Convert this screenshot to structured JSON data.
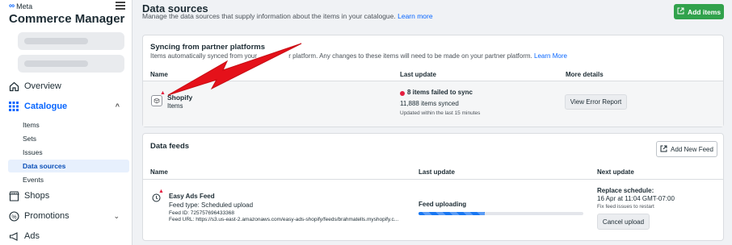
{
  "sidebar": {
    "brand": "Meta",
    "title": "Commerce Manager",
    "nav": [
      {
        "label": "Overview"
      },
      {
        "label": "Catalogue"
      },
      {
        "label": "Shops"
      },
      {
        "label": "Promotions"
      },
      {
        "label": "Ads"
      }
    ],
    "catalogue_items": [
      "Items",
      "Sets",
      "Issues",
      "Data sources",
      "Events"
    ]
  },
  "header": {
    "title": "Data sources",
    "subtitle": "Manage the data sources that supply information about the items in your catalogue.",
    "learn_more": "Learn more",
    "add_items": "Add items"
  },
  "partner": {
    "title": "Syncing from partner platforms",
    "subtitle_left": "Items automatically synced from your",
    "subtitle_right": "r platform. Any changes to these items will need to be made on your partner platform.",
    "learn_more": "Learn More",
    "col_name": "Name",
    "col_last_update": "Last update",
    "col_more": "More details",
    "row": {
      "name": "Shopify",
      "type": "Items",
      "status": "8 items failed to sync",
      "synced": "11,888 items synced",
      "updated": "Updated within the last 15 minutes",
      "button": "View Error Report"
    }
  },
  "feeds": {
    "title": "Data feeds",
    "add_button": "Add New Feed",
    "col_name": "Name",
    "col_last_update": "Last update",
    "col_next": "Next update",
    "row": {
      "name": "Easy Ads Feed",
      "feed_type": "Feed type: Scheduled upload",
      "feed_id": "Feed ID: 725757696433368",
      "feed_url": "Feed URL: https://s3.us-east-2.amazonaws.com/easy-ads-shopify/feeds/brahmatells.myshopify.c...",
      "status": "Feed uploading",
      "progress": 0.4,
      "next_title": "Replace schedule:",
      "next_time": "16 Apr at 11:04 GMT-07:00",
      "next_note": "Fix feed issues to restart",
      "cancel": "Cancel upload"
    }
  },
  "colors": {
    "accent": "#0866ff",
    "green": "#31a24c",
    "error": "#e41e3f",
    "arrow": "#e5111a"
  }
}
